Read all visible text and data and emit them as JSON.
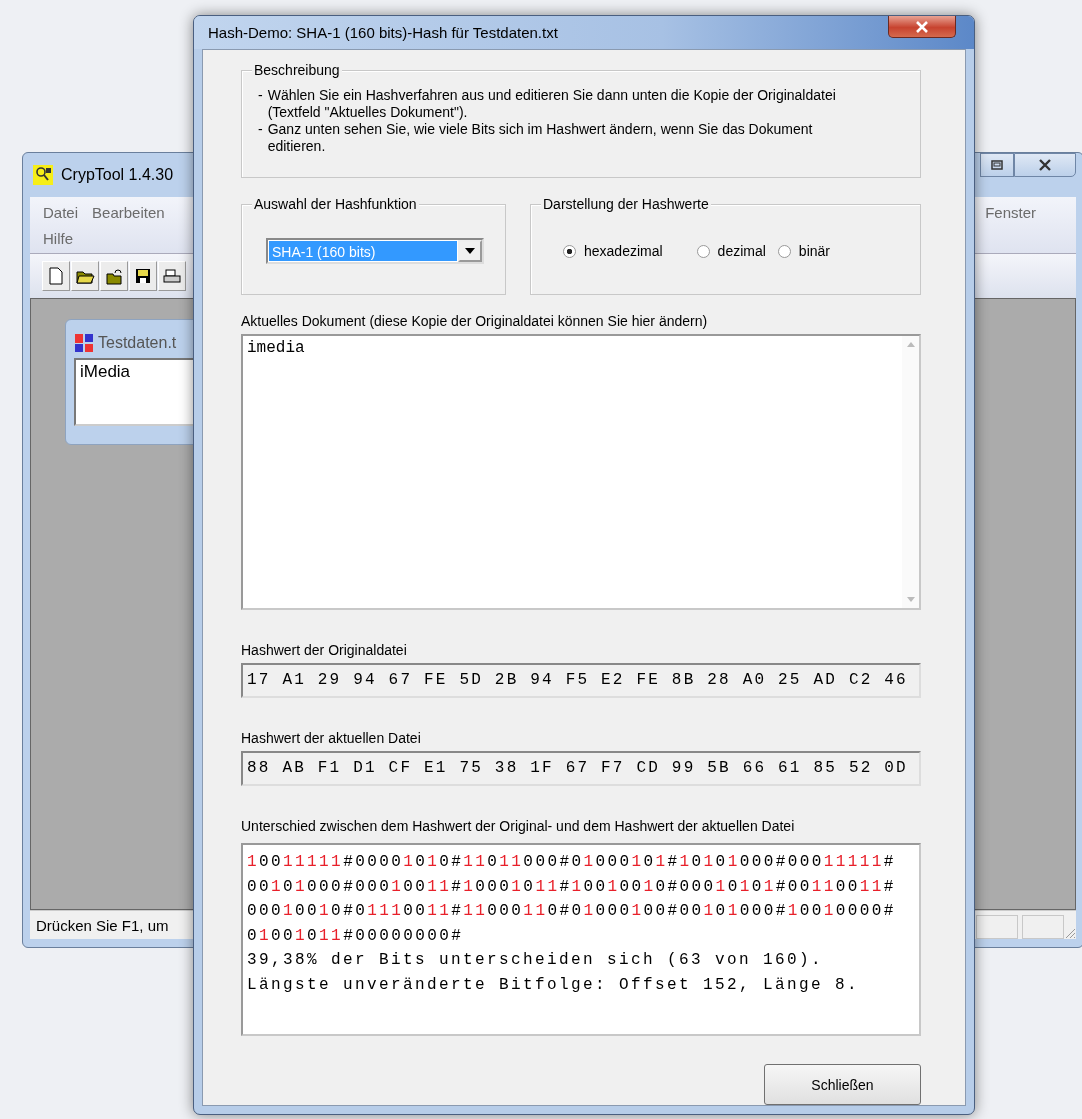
{
  "main_window": {
    "title": "CrypTool 1.4.30",
    "menu_left": [
      "Datei",
      "Bearbeiten",
      "Hilfe"
    ],
    "menu_right": [
      "Fenster"
    ],
    "child_window": {
      "title": "Testdaten.t",
      "content": "iMedia"
    },
    "status_bar": "Drücken Sie F1, um"
  },
  "dialog": {
    "title": "Hash-Demo: SHA-1 (160 bits)-Hash für Testdaten.txt",
    "description": {
      "legend": "Beschreibung",
      "items": [
        {
          "bullet": "-",
          "text": "Wählen Sie ein Hashverfahren aus und editieren Sie dann unten die Kopie der Originaldatei (Textfeld \"Aktuelles Dokument\")."
        },
        {
          "bullet": "-",
          "text": "Ganz unten sehen Sie, wie viele Bits sich im Hashwert ändern, wenn Sie das Dokument editieren."
        }
      ]
    },
    "hash_function": {
      "legend": "Auswahl der Hashfunktion",
      "value": "SHA-1 (160 bits)"
    },
    "display": {
      "legend": "Darstellung der Hashwerte",
      "options": [
        {
          "label": "hexadezimal",
          "selected": true
        },
        {
          "label": "dezimal",
          "selected": false
        },
        {
          "label": "binär",
          "selected": false
        }
      ]
    },
    "document": {
      "label": "Aktuelles Dokument (diese Kopie der Originaldatei können Sie hier ändern)",
      "value": "imedia"
    },
    "original_hash": {
      "label": "Hashwert der Originaldatei",
      "value": "17 A1 29 94 67 FE 5D 2B 94 F5 E2 FE 8B 28 A0 25 AD C2 46"
    },
    "current_hash": {
      "label": "Hashwert der aktuellen Datei",
      "value": "88 AB F1 D1 CF E1 75 38 1F 67 F7 CD 99 5B 66 61 85 52 0D"
    },
    "difference": {
      "label": "Unterschied zwischen dem Hashwert der Original- und dem Hashwert der aktuellen Datei",
      "bit_lines": [
        "10011111#00001010#11011000#01000101#10101000#00011111#",
        "00101000#00010011#10001011#10010010#00010101#00110011#",
        "00010010#01110011#11000110#01000100#00101000#10010000#",
        "01001011#00000000#"
      ],
      "text_lines": [
        "39,38% der Bits unterscheiden sich (63 von 160).",
        "Längste unveränderte Bitfolge: Offset 152, Länge 8."
      ]
    },
    "close_button": "Schließen"
  }
}
